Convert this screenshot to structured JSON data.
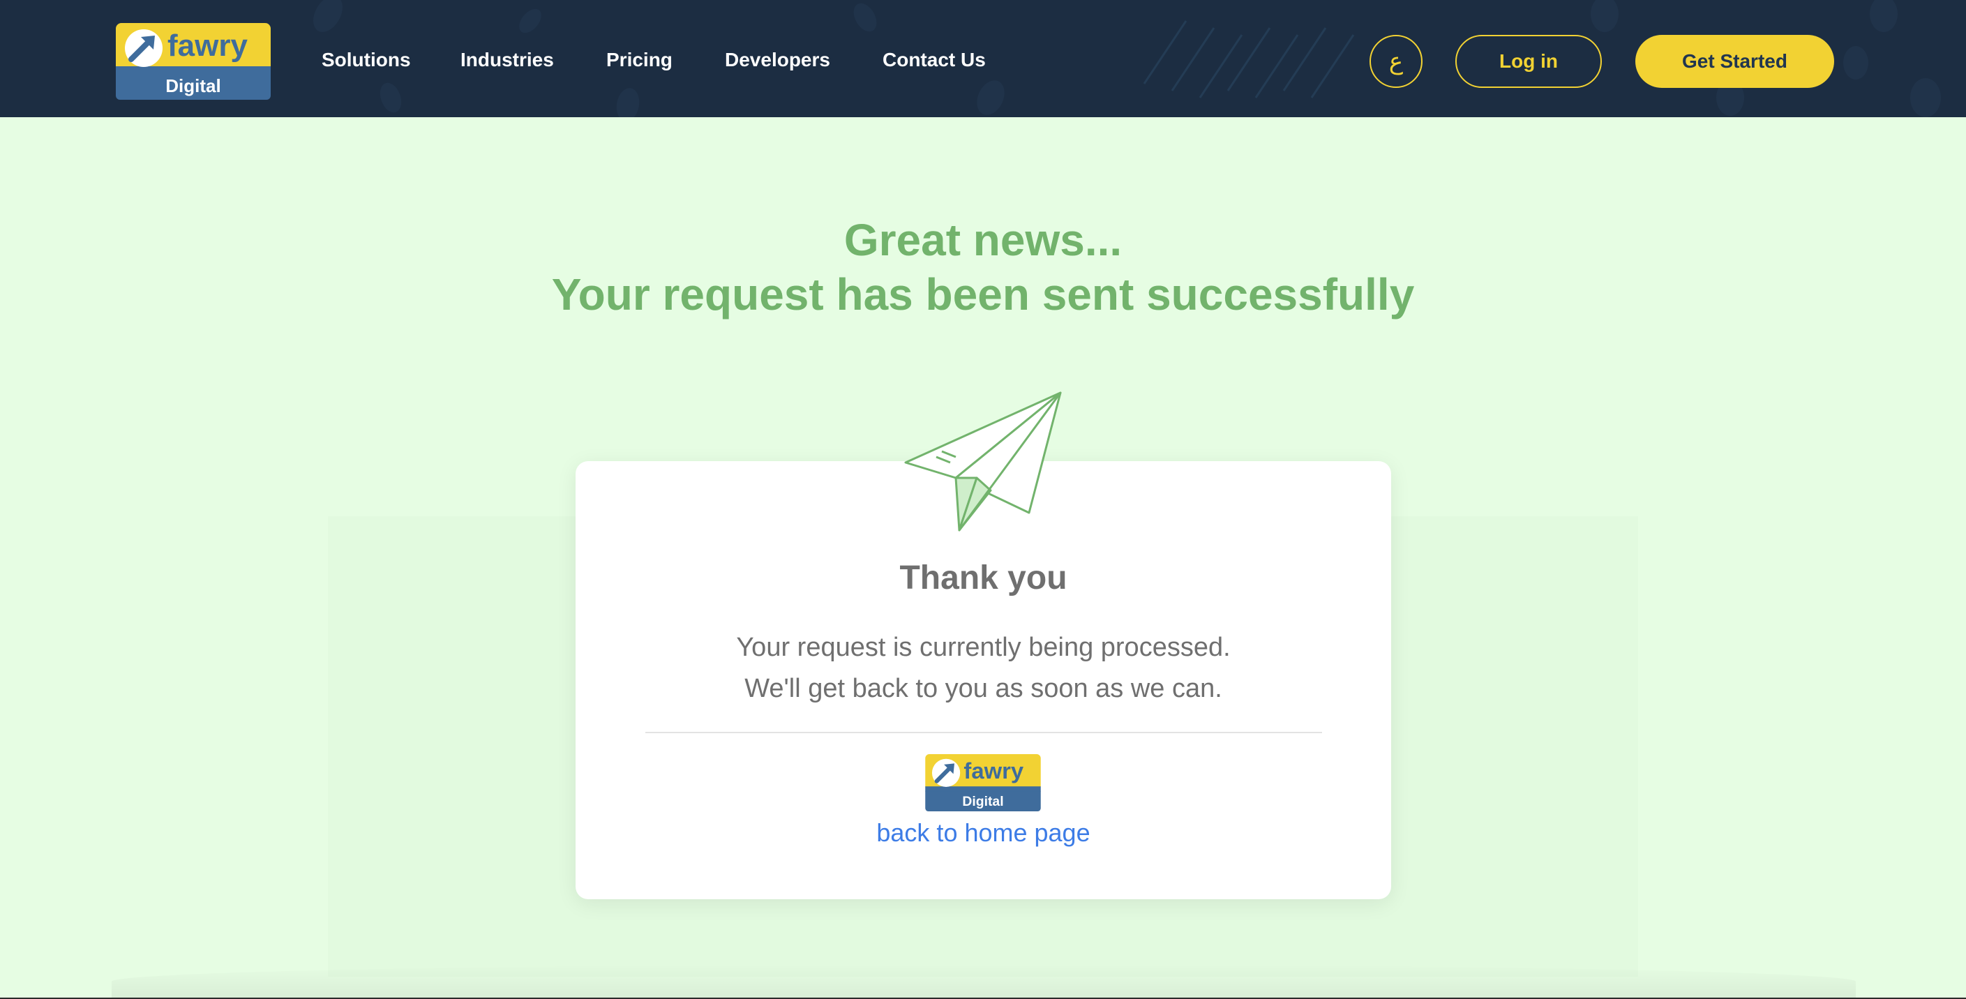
{
  "header": {
    "logo": {
      "brand": "fawry",
      "sub": "Digital"
    },
    "nav": [
      "Solutions",
      "Industries",
      "Pricing",
      "Developers",
      "Contact Us"
    ],
    "lang_label": "ع",
    "login_label": "Log in",
    "get_started_label": "Get Started"
  },
  "hero": {
    "line1": "Great news...",
    "line2": "Your request has been sent successfully"
  },
  "card": {
    "title": "Thank you",
    "message_line1": "Your request is currently being processed.",
    "message_line2": "We'll get back to you as soon as we can.",
    "logo": {
      "brand": "fawry",
      "sub": "Digital"
    },
    "link_label": "back to home page"
  },
  "colors": {
    "header_bg": "#1c2d42",
    "page_bg": "#e6fde3",
    "accent_yellow": "#f2d233",
    "logo_blue": "#3f6c9c",
    "headline_green": "#72b36c",
    "link_blue": "#3d7ce6"
  },
  "icons": [
    "paper-plane-icon",
    "fawry-logo-icon"
  ]
}
